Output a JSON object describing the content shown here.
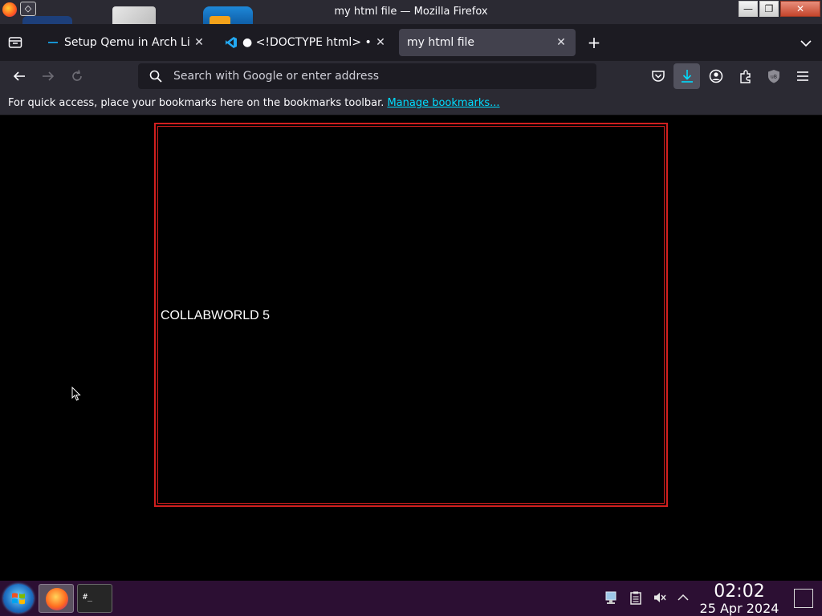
{
  "window": {
    "title": "my html file — Mozilla Firefox",
    "buttons": {
      "minimize": "—",
      "maximize": "❐",
      "close": "✕"
    }
  },
  "tabs": [
    {
      "label": "Setup Qemu in Arch Linu",
      "close": "✕",
      "icon": "arch-favicon-icon",
      "active": false
    },
    {
      "label": "● <!DOCTYPE html> • a",
      "close": "✕",
      "icon": "vscode-favicon-icon",
      "active": false
    },
    {
      "label": "my html file",
      "close": "✕",
      "icon": "",
      "active": true
    }
  ],
  "newtab_label": "+",
  "urlbar": {
    "placeholder": "Search with Google or enter address"
  },
  "bookmarks": {
    "prompt": "For quick access, place your bookmarks here on the bookmarks toolbar.",
    "link": "Manage bookmarks..."
  },
  "page": {
    "heading": "COLLABWORLD 5"
  },
  "taskbar": {
    "time": "02:02",
    "date": "25 Apr 2024",
    "terminal_label": "#_"
  },
  "colors": {
    "accent_link": "#00ddff",
    "frame_border": "#d01f1f",
    "taskbar_bg": "#2c0f33"
  }
}
